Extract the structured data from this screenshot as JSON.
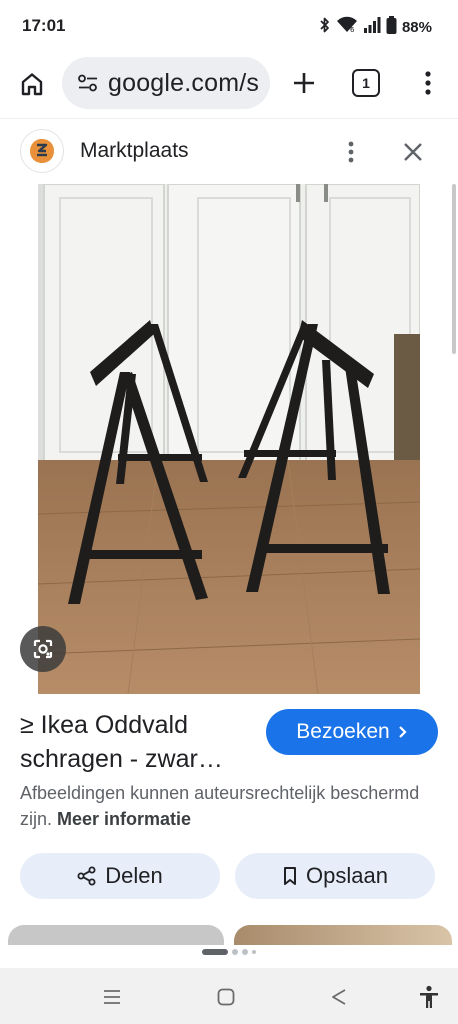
{
  "status_bar": {
    "time": "17:01",
    "battery": "88%",
    "icons": [
      "bluetooth-icon",
      "wifi-icon",
      "signal-icon",
      "battery-icon"
    ]
  },
  "browser": {
    "url": "google.com/s",
    "tab_count": "1",
    "icons": [
      "home-icon",
      "tune-icon",
      "plus-icon",
      "tabs-icon",
      "more-vert-icon"
    ]
  },
  "source": {
    "name": "Marktplaats",
    "favicon": "marktplaats-logo"
  },
  "result": {
    "title_line1": "≥ Ikea Oddvald",
    "title_line2": "schragen - zwar…",
    "visit_label": "Bezoeken",
    "copyright": "Afbeeldingen kunnen auteursrechtelijk beschermd zijn.",
    "more_info": "Meer informatie",
    "share_label": "Delen",
    "save_label": "Opslaan"
  },
  "colors": {
    "accent": "#1a73e8",
    "chip_bg": "#e8eef9",
    "marktplaats_orange": "#e8913a"
  },
  "nav_bar": {
    "icons": [
      "recents-icon",
      "home-nav-icon",
      "back-icon",
      "accessibility-icon"
    ]
  }
}
